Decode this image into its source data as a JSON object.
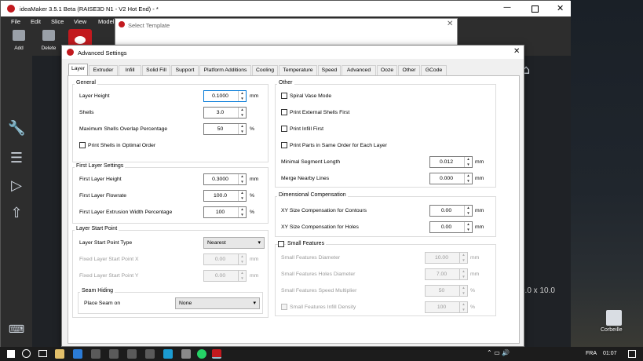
{
  "app": {
    "title": "ideaMaker 3.5.1 Beta (RAISE3D N1 - V2 Hot End) - *",
    "menu": [
      "File",
      "Edit",
      "Slice",
      "View",
      "Model"
    ],
    "toolbar": {
      "add": "Add",
      "delete": "Delete"
    },
    "viewport_text": "0.0 x 10.0"
  },
  "template_dialog": {
    "title": "Select Template"
  },
  "dialog": {
    "title": "Advanced Settings",
    "tabs": [
      "Layer",
      "Extruder",
      "Infill",
      "Solid Fill",
      "Support",
      "Platform Additions",
      "Cooling",
      "Temperature",
      "Speed",
      "Advanced",
      "Ooze",
      "Other",
      "GCode"
    ],
    "general": {
      "title": "General",
      "layer_height": {
        "label": "Layer Height",
        "value": "0.1000",
        "unit": "mm"
      },
      "shells": {
        "label": "Shells",
        "value": "3.0"
      },
      "max_overlap": {
        "label": "Maximum Shells Overlap Percentage",
        "value": "50",
        "unit": "%"
      },
      "optimal_order": {
        "label": "Print Shells in Optimal Order"
      }
    },
    "first_layer": {
      "title": "First Layer Settings",
      "height": {
        "label": "First Layer Height",
        "value": "0.3000",
        "unit": "mm"
      },
      "flowrate": {
        "label": "First Layer Flowrate",
        "value": "100.0",
        "unit": "%"
      },
      "width": {
        "label": "First Layer Extrusion Width Percentage",
        "value": "100",
        "unit": "%"
      }
    },
    "start_point": {
      "title": "Layer Start Point",
      "type": {
        "label": "Layer Start Point Type",
        "value": "Nearest"
      },
      "fixed_x": {
        "label": "Fixed Layer Start Point X",
        "value": "0.00",
        "unit": "mm"
      },
      "fixed_y": {
        "label": "Fixed Layer Start Point Y",
        "value": "0.00",
        "unit": "mm"
      },
      "seam": {
        "title": "Seam Hiding",
        "label": "Place Seam on",
        "value": "None"
      }
    },
    "other": {
      "title": "Other",
      "spiral": "Spiral Vase Mode",
      "external_first": "Print External Shells First",
      "infill_first": "Print Infill First",
      "same_order": "Print Parts in Same Order for Each Layer",
      "min_segment": {
        "label": "Minimal Segment Length",
        "value": "0.012",
        "unit": "mm"
      },
      "merge_lines": {
        "label": "Merge Nearby Lines",
        "value": "0.000",
        "unit": "mm"
      }
    },
    "dim_comp": {
      "title": "Dimensional Compensation",
      "contours": {
        "label": "XY Size Compensation for Contours",
        "value": "0.00",
        "unit": "mm"
      },
      "holes": {
        "label": "XY Size Compensation for Holes",
        "value": "0.00",
        "unit": "mm"
      }
    },
    "small": {
      "title": "Small Features",
      "diameter": {
        "label": "Small Features Diameter",
        "value": "10.00",
        "unit": "mm"
      },
      "holes_diameter": {
        "label": "Small Features Holes Diameter",
        "value": "7.00",
        "unit": "mm"
      },
      "speed": {
        "label": "Small Features Speed Multiplier",
        "value": "50",
        "unit": "%"
      },
      "infill": {
        "label": "Small Features Infill Density",
        "value": "100",
        "unit": "%"
      }
    }
  },
  "desktop": {
    "recycle_bin": "Corbeille"
  },
  "taskbar": {
    "lang": "FRA",
    "time": "01:07"
  }
}
